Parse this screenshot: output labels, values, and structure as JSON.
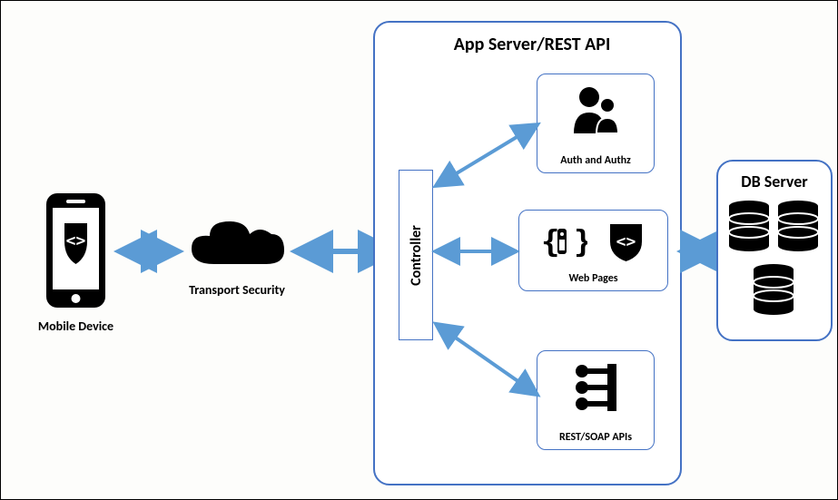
{
  "diagram": {
    "mobile_label": "Mobile Device",
    "transport_label": "Transport Security",
    "appserver_title": "App Server/REST API",
    "controller_label": "Controller",
    "auth_label": "Auth and Authz",
    "web_label": "Web Pages",
    "rest_label": "REST/SOAP  APIs",
    "db_title": "DB Server"
  }
}
